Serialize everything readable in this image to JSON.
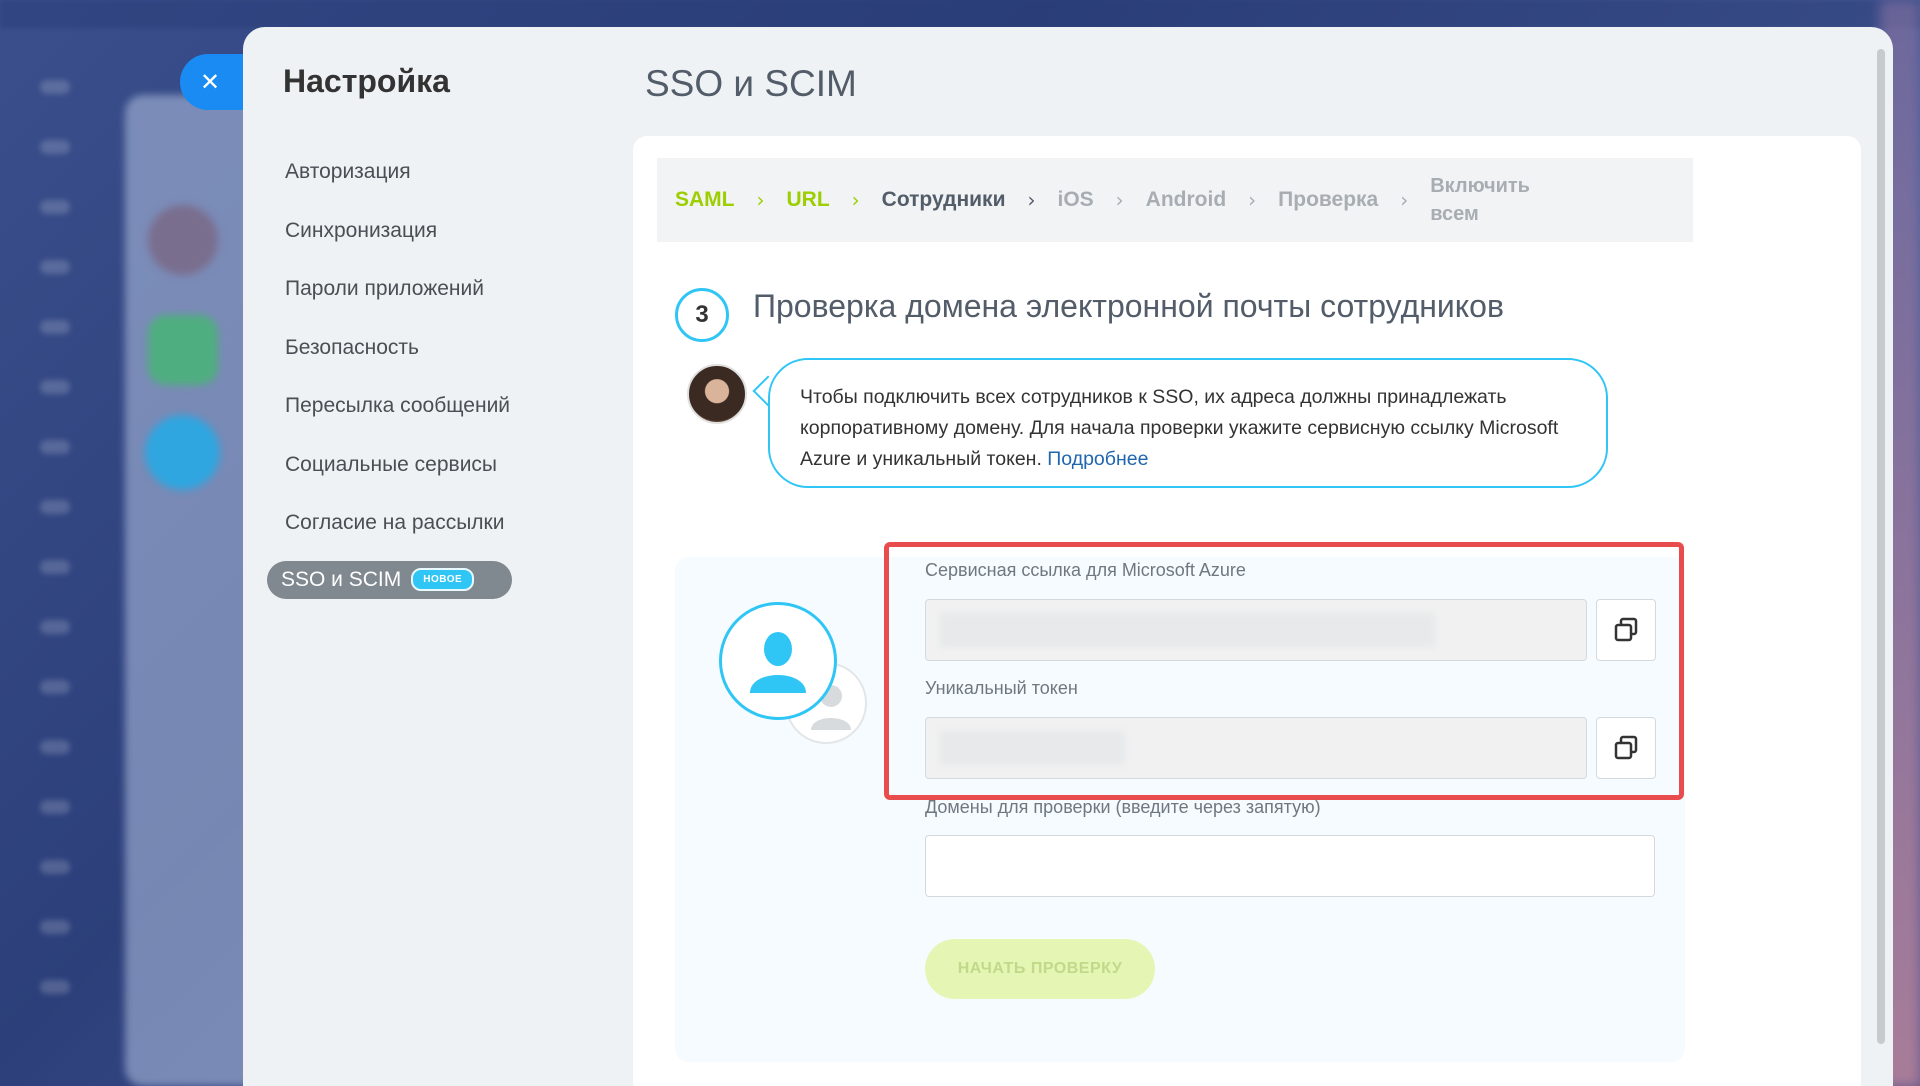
{
  "close": {
    "icon": "close-icon",
    "glyph": "✕"
  },
  "sidebar": {
    "title": "Настройка",
    "items": [
      {
        "label": "Авторизация"
      },
      {
        "label": "Синхронизация"
      },
      {
        "label": "Пароли приложений"
      },
      {
        "label": "Безопасность"
      },
      {
        "label": "Пересылка сообщений"
      },
      {
        "label": "Социальные сервисы"
      },
      {
        "label": "Согласие на рассылки"
      }
    ],
    "active": {
      "label": "SSO и SCIM",
      "badge": "НОВОЕ"
    }
  },
  "page": {
    "title": "SSO и SCIM"
  },
  "steps": [
    {
      "label": "SAML",
      "state": "done"
    },
    {
      "label": "URL",
      "state": "done"
    },
    {
      "label": "Сотрудники",
      "state": "current"
    },
    {
      "label": "iOS",
      "state": "pending"
    },
    {
      "label": "Android",
      "state": "pending"
    },
    {
      "label": "Проверка",
      "state": "pending"
    },
    {
      "label": "Включить всем",
      "state": "pending"
    }
  ],
  "section": {
    "number": "3",
    "title": "Проверка домена электронной почты сотрудников"
  },
  "bubble": {
    "text": "Чтобы подключить всех сотрудников к SSO, их адреса должны принадлежать корпоративному домену. Для начала проверки укажите сервисную ссылку Microsoft Azure и уникальный токен. ",
    "link": "Подробнее"
  },
  "form": {
    "azure_label": "Сервисная ссылка для Microsoft Azure",
    "azure_value": "",
    "token_label": "Уникальный токен",
    "token_value": "",
    "domains_label": "Домены для проверки (введите через запятую)",
    "domains_value": "",
    "start_button": "НАЧАТЬ ПРОВЕРКУ"
  },
  "colors": {
    "accent": "#2fc6f6",
    "done_step": "#9dcf00",
    "highlight": "#e84c4c",
    "close_button": "#1a8bf2"
  }
}
